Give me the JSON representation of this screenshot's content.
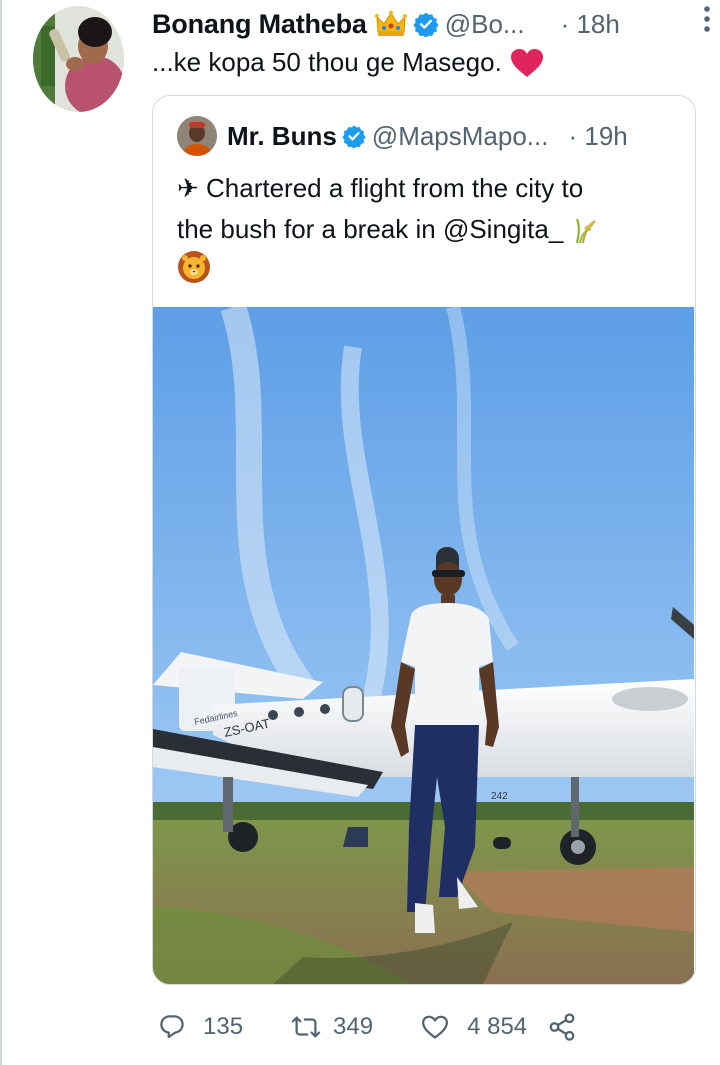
{
  "tweet": {
    "author_name": "Bonang Matheba",
    "author_handle": "@Bo...",
    "time": "· 18h",
    "text": "...ke kopa 50 thou ge Masego.",
    "icons": [
      "crown-icon",
      "verified-badge-icon",
      "more-icon",
      "red-heart-icon"
    ]
  },
  "quote": {
    "author_name": "Mr. Buns",
    "author_handle": "@MapsMapo...",
    "time": "· 19h",
    "line1": "✈ Chartered a flight from the city to",
    "line2": "the bush for a break in @Singita_",
    "icons": [
      "verified-badge-icon",
      "grass-icon",
      "lion-face-icon"
    ],
    "photo": {
      "plane_registration": "ZS-OAT",
      "airline_text": "Fedairlines",
      "tail_number": "242"
    }
  },
  "actions": {
    "replies": "135",
    "retweets": "349",
    "likes": "4 854"
  },
  "colors": {
    "text": "#0f1419",
    "muted": "#536471",
    "verified": "#1d9bf0",
    "border": "#cfd9de",
    "heart": "#e0245e"
  }
}
